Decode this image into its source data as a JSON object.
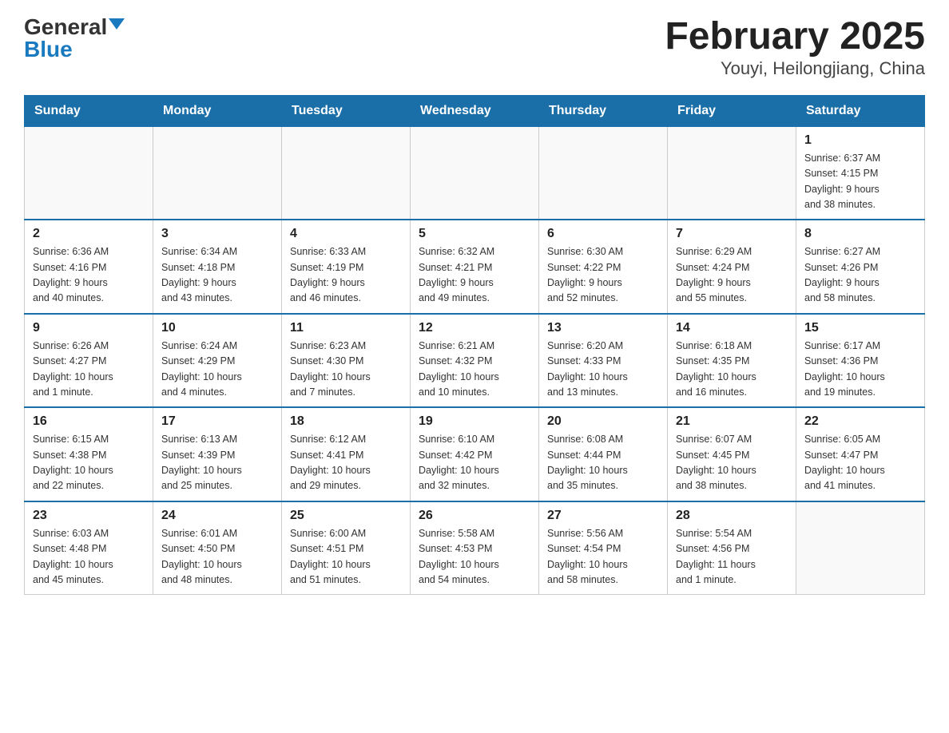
{
  "logo": {
    "general_text": "General",
    "blue_text": "Blue"
  },
  "title": "February 2025",
  "subtitle": "Youyi, Heilongjiang, China",
  "headers": [
    "Sunday",
    "Monday",
    "Tuesday",
    "Wednesday",
    "Thursday",
    "Friday",
    "Saturday"
  ],
  "weeks": [
    [
      {
        "day": "",
        "info": ""
      },
      {
        "day": "",
        "info": ""
      },
      {
        "day": "",
        "info": ""
      },
      {
        "day": "",
        "info": ""
      },
      {
        "day": "",
        "info": ""
      },
      {
        "day": "",
        "info": ""
      },
      {
        "day": "1",
        "info": "Sunrise: 6:37 AM\nSunset: 4:15 PM\nDaylight: 9 hours\nand 38 minutes."
      }
    ],
    [
      {
        "day": "2",
        "info": "Sunrise: 6:36 AM\nSunset: 4:16 PM\nDaylight: 9 hours\nand 40 minutes."
      },
      {
        "day": "3",
        "info": "Sunrise: 6:34 AM\nSunset: 4:18 PM\nDaylight: 9 hours\nand 43 minutes."
      },
      {
        "day": "4",
        "info": "Sunrise: 6:33 AM\nSunset: 4:19 PM\nDaylight: 9 hours\nand 46 minutes."
      },
      {
        "day": "5",
        "info": "Sunrise: 6:32 AM\nSunset: 4:21 PM\nDaylight: 9 hours\nand 49 minutes."
      },
      {
        "day": "6",
        "info": "Sunrise: 6:30 AM\nSunset: 4:22 PM\nDaylight: 9 hours\nand 52 minutes."
      },
      {
        "day": "7",
        "info": "Sunrise: 6:29 AM\nSunset: 4:24 PM\nDaylight: 9 hours\nand 55 minutes."
      },
      {
        "day": "8",
        "info": "Sunrise: 6:27 AM\nSunset: 4:26 PM\nDaylight: 9 hours\nand 58 minutes."
      }
    ],
    [
      {
        "day": "9",
        "info": "Sunrise: 6:26 AM\nSunset: 4:27 PM\nDaylight: 10 hours\nand 1 minute."
      },
      {
        "day": "10",
        "info": "Sunrise: 6:24 AM\nSunset: 4:29 PM\nDaylight: 10 hours\nand 4 minutes."
      },
      {
        "day": "11",
        "info": "Sunrise: 6:23 AM\nSunset: 4:30 PM\nDaylight: 10 hours\nand 7 minutes."
      },
      {
        "day": "12",
        "info": "Sunrise: 6:21 AM\nSunset: 4:32 PM\nDaylight: 10 hours\nand 10 minutes."
      },
      {
        "day": "13",
        "info": "Sunrise: 6:20 AM\nSunset: 4:33 PM\nDaylight: 10 hours\nand 13 minutes."
      },
      {
        "day": "14",
        "info": "Sunrise: 6:18 AM\nSunset: 4:35 PM\nDaylight: 10 hours\nand 16 minutes."
      },
      {
        "day": "15",
        "info": "Sunrise: 6:17 AM\nSunset: 4:36 PM\nDaylight: 10 hours\nand 19 minutes."
      }
    ],
    [
      {
        "day": "16",
        "info": "Sunrise: 6:15 AM\nSunset: 4:38 PM\nDaylight: 10 hours\nand 22 minutes."
      },
      {
        "day": "17",
        "info": "Sunrise: 6:13 AM\nSunset: 4:39 PM\nDaylight: 10 hours\nand 25 minutes."
      },
      {
        "day": "18",
        "info": "Sunrise: 6:12 AM\nSunset: 4:41 PM\nDaylight: 10 hours\nand 29 minutes."
      },
      {
        "day": "19",
        "info": "Sunrise: 6:10 AM\nSunset: 4:42 PM\nDaylight: 10 hours\nand 32 minutes."
      },
      {
        "day": "20",
        "info": "Sunrise: 6:08 AM\nSunset: 4:44 PM\nDaylight: 10 hours\nand 35 minutes."
      },
      {
        "day": "21",
        "info": "Sunrise: 6:07 AM\nSunset: 4:45 PM\nDaylight: 10 hours\nand 38 minutes."
      },
      {
        "day": "22",
        "info": "Sunrise: 6:05 AM\nSunset: 4:47 PM\nDaylight: 10 hours\nand 41 minutes."
      }
    ],
    [
      {
        "day": "23",
        "info": "Sunrise: 6:03 AM\nSunset: 4:48 PM\nDaylight: 10 hours\nand 45 minutes."
      },
      {
        "day": "24",
        "info": "Sunrise: 6:01 AM\nSunset: 4:50 PM\nDaylight: 10 hours\nand 48 minutes."
      },
      {
        "day": "25",
        "info": "Sunrise: 6:00 AM\nSunset: 4:51 PM\nDaylight: 10 hours\nand 51 minutes."
      },
      {
        "day": "26",
        "info": "Sunrise: 5:58 AM\nSunset: 4:53 PM\nDaylight: 10 hours\nand 54 minutes."
      },
      {
        "day": "27",
        "info": "Sunrise: 5:56 AM\nSunset: 4:54 PM\nDaylight: 10 hours\nand 58 minutes."
      },
      {
        "day": "28",
        "info": "Sunrise: 5:54 AM\nSunset: 4:56 PM\nDaylight: 11 hours\nand 1 minute."
      },
      {
        "day": "",
        "info": ""
      }
    ]
  ]
}
